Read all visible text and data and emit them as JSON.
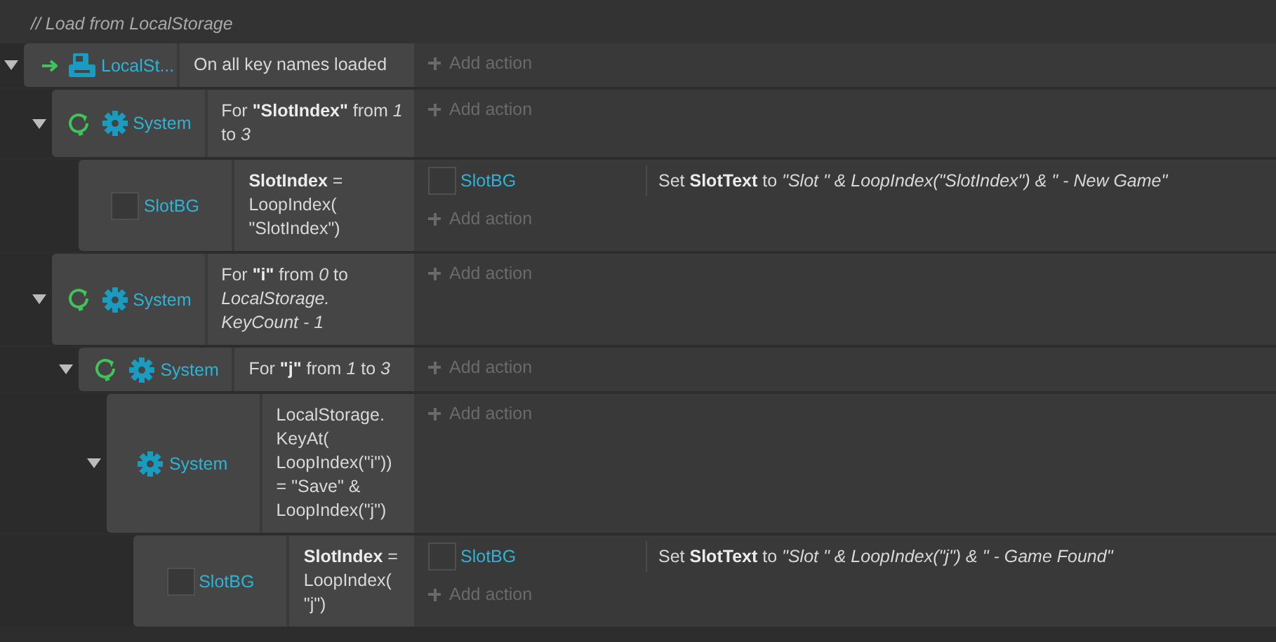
{
  "comment": "// Load from LocalStorage",
  "events": [
    {
      "kind": "trigger",
      "expanded": true,
      "object": {
        "kind": "storage",
        "name": "LocalSt..."
      },
      "condition": "On all key names loaded",
      "add_action": "Add action",
      "children": [
        {
          "kind": "loop",
          "expanded": true,
          "object": {
            "kind": "system",
            "name": "System"
          },
          "condition": "For **\"SlotIndex\"** from *1* to *3*",
          "add_action": "Add action",
          "children": [
            {
              "object": {
                "kind": "sprite",
                "name": "SlotBG"
              },
              "condition": "**SlotIndex** = LoopIndex(\"SlotIndex\")",
              "actions": [
                {
                  "object": {
                    "kind": "sprite",
                    "name": "SlotBG"
                  },
                  "text": "Set **SlotText** to *\"Slot \" & LoopIndex(\"SlotIndex\") & \" - New Game\"*"
                }
              ],
              "add_action": "Add action"
            }
          ]
        },
        {
          "kind": "loop",
          "expanded": true,
          "object": {
            "kind": "system",
            "name": "System"
          },
          "condition": "For **\"i\"** from *0* to *LocalStorage. KeyCount - 1*",
          "add_action": "Add action",
          "children": [
            {
              "kind": "loop",
              "expanded": true,
              "object": {
                "kind": "system",
                "name": "System"
              },
              "condition": "For **\"j\"** from *1* to *3*",
              "add_action": "Add action",
              "children": [
                {
                  "expanded": true,
                  "object": {
                    "kind": "system",
                    "name": "System"
                  },
                  "condition": "LocalStorage.KeyAt(LoopIndex(\"i\")) = \"Save\" & LoopIndex(\"j\")",
                  "add_action": "Add action",
                  "children": [
                    {
                      "object": {
                        "kind": "sprite",
                        "name": "SlotBG"
                      },
                      "condition": "**SlotIndex** = LoopIndex(\"j\")",
                      "actions": [
                        {
                          "object": {
                            "kind": "sprite",
                            "name": "SlotBG"
                          },
                          "text": "Set **SlotText** to *\"Slot \" & LoopIndex(\"j\") & \" - Game Found\"*"
                        }
                      ],
                      "add_action": "Add action"
                    }
                  ]
                }
              ]
            }
          ]
        }
      ]
    }
  ]
}
